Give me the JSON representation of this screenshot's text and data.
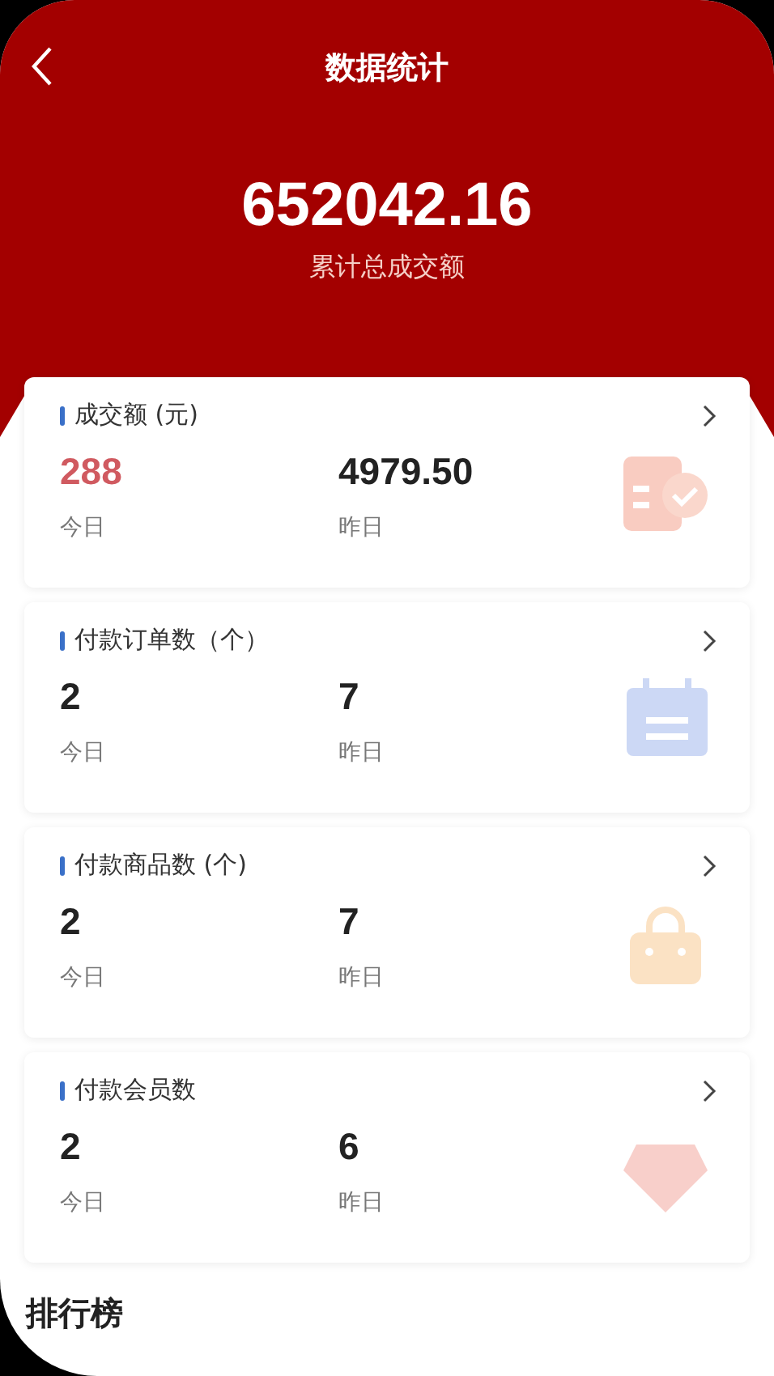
{
  "header": {
    "title": "数据统计",
    "total": "652042.16",
    "total_label": "累计总成交额"
  },
  "cards": [
    {
      "title": "成交额 (元)",
      "kind": "receipt",
      "today": "288",
      "today_label": "今日",
      "today_highlight": true,
      "yesterday": "4979.50",
      "yesterday_label": "昨日"
    },
    {
      "title": "付款订单数（个）",
      "kind": "calendar",
      "today": "2",
      "today_label": "今日",
      "today_highlight": false,
      "yesterday": "7",
      "yesterday_label": "昨日"
    },
    {
      "title": "付款商品数 (个)",
      "kind": "bag",
      "today": "2",
      "today_label": "今日",
      "today_highlight": false,
      "yesterday": "7",
      "yesterday_label": "昨日"
    },
    {
      "title": "付款会员数",
      "kind": "gem",
      "today": "2",
      "today_label": "今日",
      "today_highlight": false,
      "yesterday": "6",
      "yesterday_label": "昨日"
    }
  ],
  "ranking": {
    "title": "排行榜"
  }
}
